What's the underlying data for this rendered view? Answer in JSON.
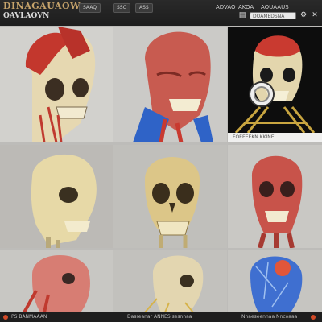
{
  "app": {
    "title_line1": "DINAGAUAOW",
    "title_line2": "OAVLAOVN"
  },
  "toolbar": {
    "buttons": [
      "SAAQ",
      "SSC",
      "ASS"
    ],
    "nav": [
      "ADVAO",
      "AKOA",
      "AOUAAUS"
    ],
    "search_placeholder": "DOAMEDSNA"
  },
  "tiles": [
    {
      "caption": ""
    },
    {
      "caption": ""
    },
    {
      "caption": "FOEEEEKN        KKINE"
    },
    {
      "caption": ""
    },
    {
      "caption": ""
    },
    {
      "caption": ""
    },
    {
      "caption": ""
    },
    {
      "caption": ""
    },
    {
      "caption": ""
    }
  ],
  "bottombar": {
    "left_text": "PS BANMAAAN",
    "middle_text": "Dasreanar ANNES sesnnaa",
    "right_text": "Nnaeseennaa Nncoaaa"
  },
  "colors": {
    "muscle": "#c94a42",
    "bone": "#e7d9b0",
    "vein": "#2f63c7",
    "accent_red": "#d24a28"
  }
}
